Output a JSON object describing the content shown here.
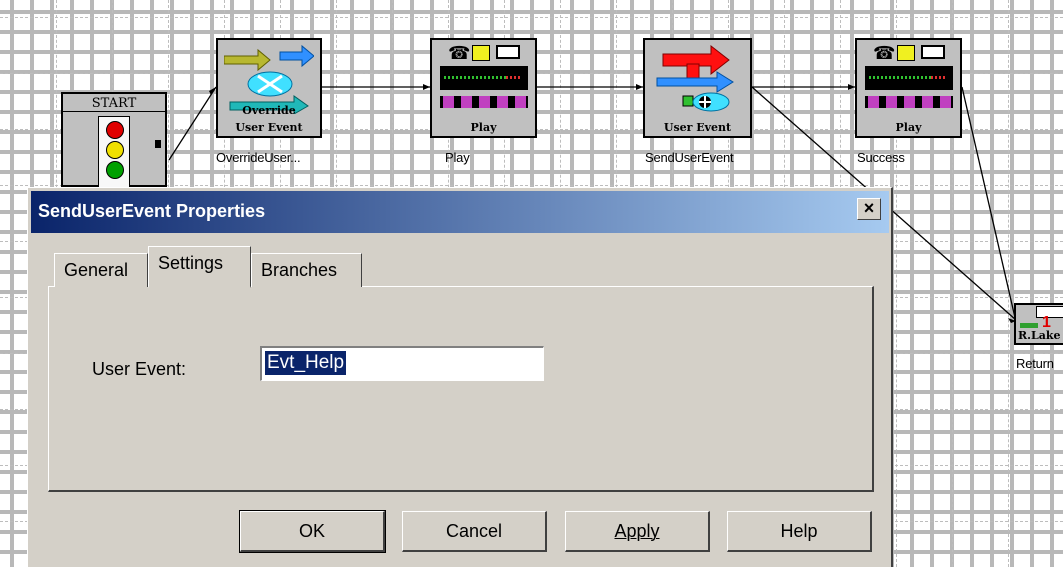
{
  "flow_nodes": {
    "start": {
      "caption": "START"
    },
    "override": {
      "caption_top": "Override",
      "caption": "User Event",
      "label": "OverrideUser..."
    },
    "play1": {
      "caption": "Play",
      "label": "Play"
    },
    "send": {
      "caption": "User Event",
      "label": "SendUserEvent"
    },
    "success": {
      "caption": "Play",
      "label": "Success"
    },
    "return": {
      "caption": "R.Lake",
      "label": "Return"
    }
  },
  "dialog": {
    "title": "SendUserEvent Properties",
    "close_label": "×",
    "tabs": {
      "general": "General",
      "settings": "Settings",
      "branches": "Branches"
    },
    "active_tab": "Settings",
    "user_event_label": "User Event:",
    "user_event_value": "Evt_Help",
    "buttons": {
      "ok": "OK",
      "cancel": "Cancel",
      "apply": "Apply",
      "help": "Help"
    }
  },
  "colors": {
    "titlebar_start": "#0a246a",
    "titlebar_end": "#a6caf0",
    "face": "#d4d0c8",
    "selection": "#0a246a"
  }
}
